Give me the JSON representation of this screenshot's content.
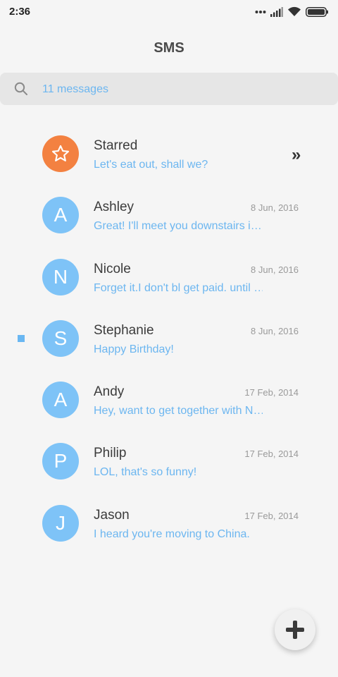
{
  "status_bar": {
    "time": "2:36"
  },
  "header": {
    "title": "SMS"
  },
  "search": {
    "placeholder": "11 messages"
  },
  "colors": {
    "accent": "#6cb6f0",
    "avatar": "#7ec3f7",
    "starred": "#f38141"
  },
  "starred": {
    "name": "Starred",
    "preview": "Let's eat out, shall we?",
    "icon": "star-icon",
    "arrow": "»"
  },
  "conversations": [
    {
      "initial": "A",
      "name": "Ashley",
      "date": "8 Jun, 2016",
      "preview": "Great! I'll meet you downstairs i…",
      "unread": false
    },
    {
      "initial": "N",
      "name": "Nicole",
      "date": "8 Jun, 2016",
      "preview": "Forget it.I don't bl get paid. until …",
      "unread": false
    },
    {
      "initial": "S",
      "name": "Stephanie",
      "date": "8 Jun, 2016",
      "preview": "Happy Birthday!",
      "unread": true
    },
    {
      "initial": "A",
      "name": "Andy",
      "date": "17 Feb, 2014",
      "preview": "Hey, want to get together with N…",
      "unread": false
    },
    {
      "initial": "P",
      "name": "Philip",
      "date": "17 Feb, 2014",
      "preview": "LOL, that's so funny!",
      "unread": false
    },
    {
      "initial": "J",
      "name": "Jason",
      "date": "17 Feb, 2014",
      "preview": "I heard you're moving to China.",
      "unread": false
    }
  ],
  "fab": {
    "icon": "plus-icon"
  }
}
